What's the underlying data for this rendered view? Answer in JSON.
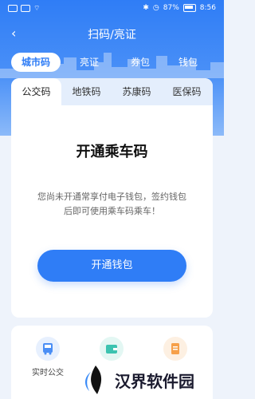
{
  "status_bar": {
    "battery": "87%",
    "time": "8:56"
  },
  "nav": {
    "back_icon": "chevron-left-icon",
    "title": "扫码/亮证"
  },
  "top_tabs": [
    {
      "label": "城市码",
      "active": true
    },
    {
      "label": "亮证"
    },
    {
      "label": "券包"
    },
    {
      "label": "钱包"
    }
  ],
  "sub_tabs": [
    {
      "label": "公交码",
      "active": true
    },
    {
      "label": "地铁码"
    },
    {
      "label": "苏康码"
    },
    {
      "label": "医保码"
    }
  ],
  "card": {
    "title": "开通乘车码",
    "description": "您尚未开通常享付电子钱包，签约钱包后即可使用乘车码乘车！",
    "button": "开通钱包"
  },
  "services": [
    {
      "label": "实时公交",
      "icon": "bus-icon",
      "color": "#4a8ef5"
    },
    {
      "label": "",
      "icon": "wallet-icon",
      "color": "#3cc3b0"
    },
    {
      "label": "",
      "icon": "document-icon",
      "color": "#f6a04a"
    }
  ],
  "watermark": {
    "text": "汉界软件园"
  },
  "colors": {
    "primary": "#2f7df6",
    "background": "#eef3fb"
  }
}
